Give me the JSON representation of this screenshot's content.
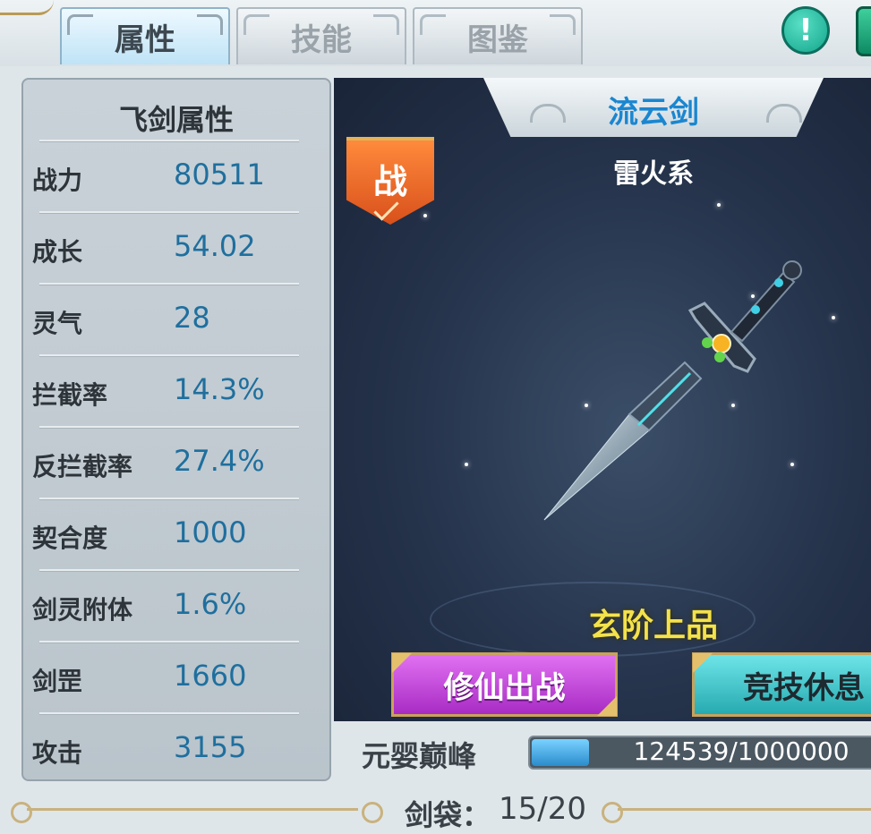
{
  "tabs": [
    {
      "label": "属性",
      "active": true
    },
    {
      "label": "技能",
      "active": false
    },
    {
      "label": "图鉴",
      "active": false
    }
  ],
  "top_right": {
    "info_icon": "exclamation-icon",
    "info_glyph": "!"
  },
  "panel": {
    "title": "飞剑属性",
    "stats": [
      {
        "label": "战力",
        "value": "80511"
      },
      {
        "label": "成长",
        "value": "54.02"
      },
      {
        "label": "灵气",
        "value": "28"
      },
      {
        "label": "拦截率",
        "value": "14.3%"
      },
      {
        "label": "反拦截率",
        "value": "27.4%"
      },
      {
        "label": "契合度",
        "value": "1000"
      },
      {
        "label": "剑灵附体",
        "value": "1.6%"
      },
      {
        "label": "剑罡",
        "value": "1660"
      },
      {
        "label": "攻击",
        "value": "3155"
      }
    ]
  },
  "sword": {
    "name": "流云剑",
    "element": "雷火系",
    "grade": "玄阶上品",
    "badge": "战"
  },
  "actions": {
    "fight_label": "修仙出战",
    "rest_label": "竞技休息"
  },
  "realm": {
    "label": "元婴巅峰",
    "exp_text": "124539/1000000",
    "exp_current": 124539,
    "exp_max": 1000000
  },
  "bag": {
    "label": "剑袋：",
    "value": "15/20"
  },
  "colors": {
    "stat_value": "#1f6f9e",
    "grade": "#f4e24b",
    "name": "#1a86d0",
    "fight_button": "#c24fdc",
    "rest_button": "#3cc4c8"
  }
}
